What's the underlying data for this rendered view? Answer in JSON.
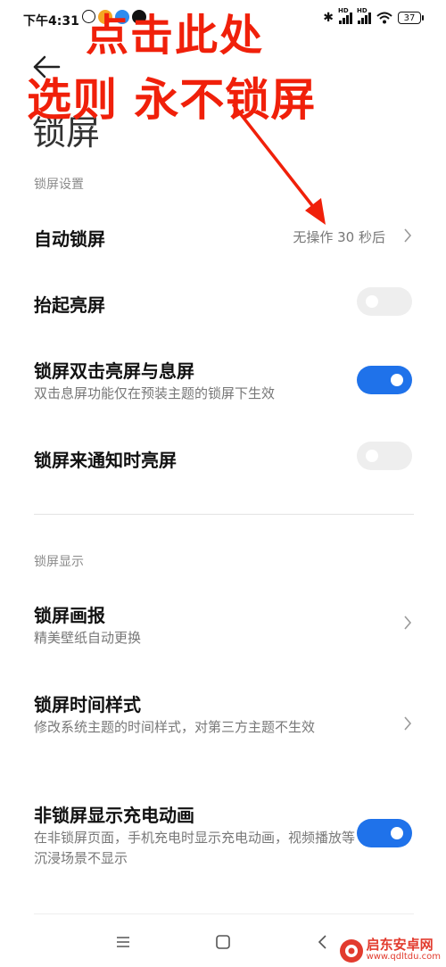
{
  "status_bar": {
    "time": "下午4:31",
    "battery": "37"
  },
  "header": {
    "title": "锁屏"
  },
  "sections": [
    {
      "header": "锁屏设置",
      "items": [
        {
          "title": "自动锁屏",
          "value": "无操作 30 秒后"
        },
        {
          "title": "抬起亮屏",
          "toggle": "off"
        },
        {
          "title": "锁屏双击亮屏与息屏",
          "subtitle": "双击息屏功能仅在预装主题的锁屏下生效",
          "toggle": "on"
        },
        {
          "title": "锁屏来通知时亮屏",
          "toggle": "off"
        }
      ]
    },
    {
      "header": "锁屏显示",
      "items": [
        {
          "title": "锁屏画报",
          "subtitle": "精美壁纸自动更换"
        },
        {
          "title": "锁屏时间样式",
          "subtitle": "修改系统主题的时间样式，对第三方主题不生效"
        },
        {
          "title": "非锁屏显示充电动画",
          "subtitle": "在非锁屏页面，手机充电时显示充电动画，视频播放等沉浸场景不显示",
          "toggle": "on"
        }
      ]
    }
  ],
  "annotations": {
    "line1": "点击此处",
    "line2": "选则 永不锁屏",
    "color": "#f0200a"
  },
  "watermark": {
    "name": "启东安卓网",
    "url": "www.qdltdu.com"
  },
  "colors": {
    "accent": "#1f72ea",
    "toggle_off": "#eeeeee",
    "secondary_text": "#777777"
  }
}
